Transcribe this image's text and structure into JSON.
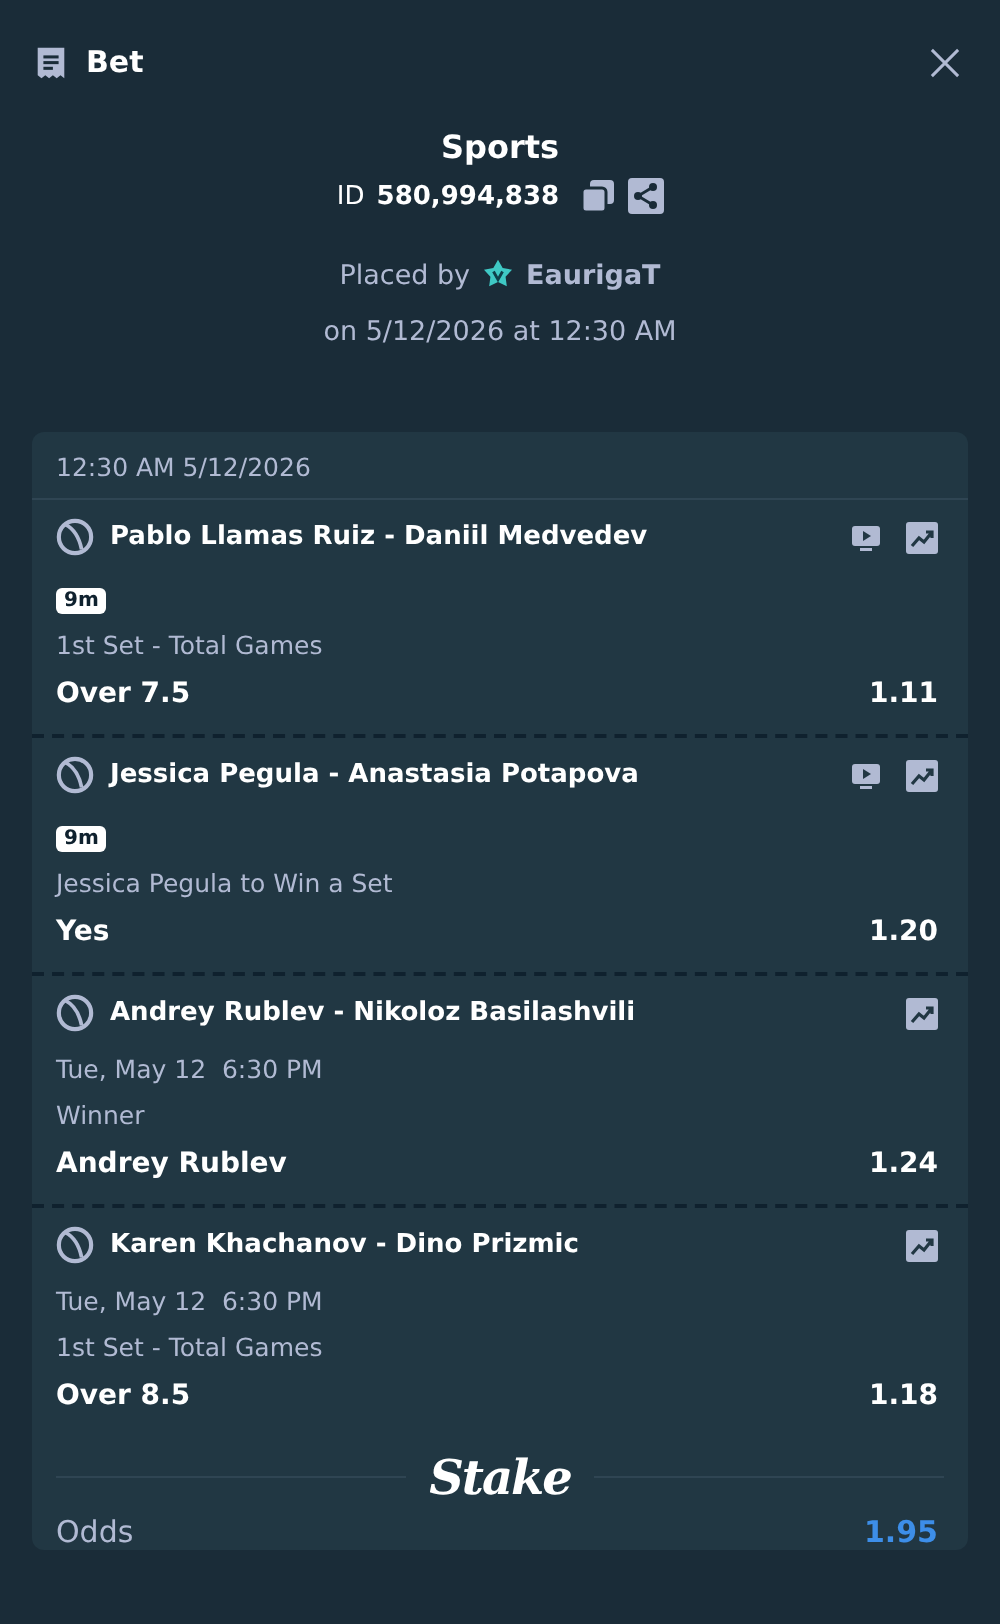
{
  "window": {
    "title": "Bet"
  },
  "summary": {
    "category": "Sports",
    "id_label": "ID",
    "id_value": "580,994,838",
    "placed_by_label": "Placed by",
    "username": "EaurigaT",
    "placed_on": "on 5/12/2026 at 12:30 AM"
  },
  "bet_card": {
    "header_time": "12:30 AM 5/12/2026",
    "legs": [
      {
        "kind": "live",
        "match": "Pablo Llamas Ruiz - Daniil Medvedev",
        "live_stream": true,
        "badge": "9m",
        "market": "1st Set - Total Games",
        "selection": "Over 7.5",
        "odds": "1.11"
      },
      {
        "kind": "live",
        "match": "Jessica Pegula - Anastasia Potapova",
        "live_stream": true,
        "badge": "9m",
        "market": "Jessica Pegula to Win a Set",
        "selection": "Yes",
        "odds": "1.20"
      },
      {
        "kind": "scheduled",
        "match": "Andrey Rublev - Nikoloz Basilashvili",
        "live_stream": false,
        "start_time": "Tue, May 12  6:30 PM",
        "market": "Winner",
        "selection": "Andrey Rublev",
        "odds": "1.24"
      },
      {
        "kind": "scheduled",
        "match": "Karen Khachanov - Dino Prizmic",
        "live_stream": false,
        "start_time": "Tue, May 12  6:30 PM",
        "market": "1st Set - Total Games",
        "selection": "Over 8.5",
        "odds": "1.18"
      }
    ],
    "brand": "Stake",
    "totals": [
      {
        "label": "Odds",
        "value": "1.95"
      }
    ]
  }
}
